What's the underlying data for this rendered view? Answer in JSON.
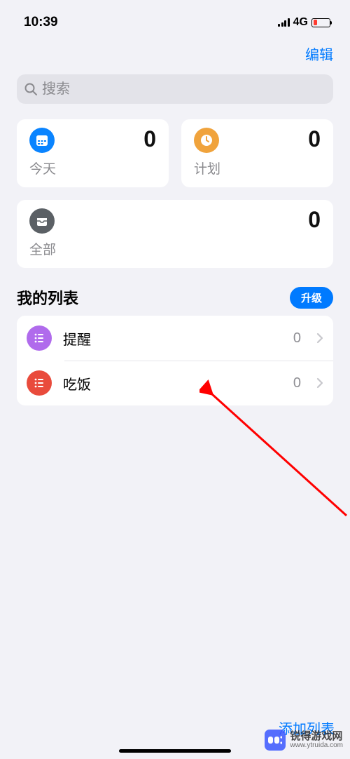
{
  "status": {
    "time": "10:39",
    "network": "4G"
  },
  "nav": {
    "edit": "编辑"
  },
  "search": {
    "placeholder": "搜索"
  },
  "cards": {
    "today": {
      "label": "今天",
      "count": "0",
      "iconColor": "#0a84ff"
    },
    "planned": {
      "label": "计划",
      "count": "0",
      "iconColor": "#f0a33c"
    },
    "all": {
      "label": "全部",
      "count": "0",
      "iconColor": "#5b6065"
    }
  },
  "section": {
    "title": "我的列表",
    "upgrade": "升级"
  },
  "lists": [
    {
      "name": "提醒",
      "count": "0",
      "color": "#b06becff"
    },
    {
      "name": "吃饭",
      "count": "0",
      "color": "#e94b3c"
    }
  ],
  "bottom": {
    "addList": "添加列表"
  },
  "watermark": {
    "main": "锐得游戏网",
    "sub": "www.ytruida.com"
  }
}
